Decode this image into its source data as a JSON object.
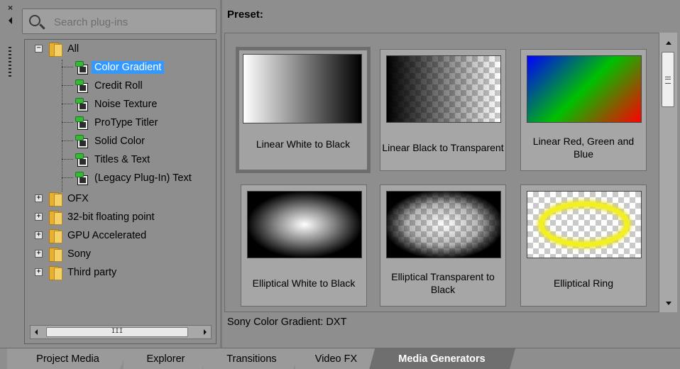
{
  "search": {
    "placeholder": "Search plug-ins"
  },
  "tree": {
    "root": {
      "label": "All"
    },
    "plugins": [
      {
        "label": "Color Gradient",
        "selected": true
      },
      {
        "label": "Credit Roll"
      },
      {
        "label": "Noise Texture"
      },
      {
        "label": "ProType Titler"
      },
      {
        "label": "Solid Color"
      },
      {
        "label": "Titles & Text"
      },
      {
        "label": "(Legacy Plug-In) Text"
      }
    ],
    "folders": [
      {
        "label": "OFX"
      },
      {
        "label": "32-bit floating point"
      },
      {
        "label": "GPU Accelerated"
      },
      {
        "label": "Sony"
      },
      {
        "label": "Third party"
      }
    ]
  },
  "hscroll": {
    "thumb_grip": "III"
  },
  "preset": {
    "heading": "Preset:",
    "tiles": [
      {
        "caption": "Linear White to Black",
        "selected": true
      },
      {
        "caption": "Linear Black to Transparent"
      },
      {
        "caption": "Linear Red, Green and Blue"
      },
      {
        "caption": "Elliptical White to Black"
      },
      {
        "caption": "Elliptical Transparent to Black"
      },
      {
        "caption": "Elliptical Ring"
      }
    ]
  },
  "status": {
    "text": "Sony Color Gradient: DXT"
  },
  "tabs": [
    {
      "label": "Project Media"
    },
    {
      "label": "Explorer"
    },
    {
      "label": "Transitions"
    },
    {
      "label": "Video FX"
    },
    {
      "label": "Media Generators",
      "active": true
    }
  ],
  "colors": {
    "selection": "#3399ff",
    "background": "#8e8e8e",
    "ring": "#f2f020"
  }
}
